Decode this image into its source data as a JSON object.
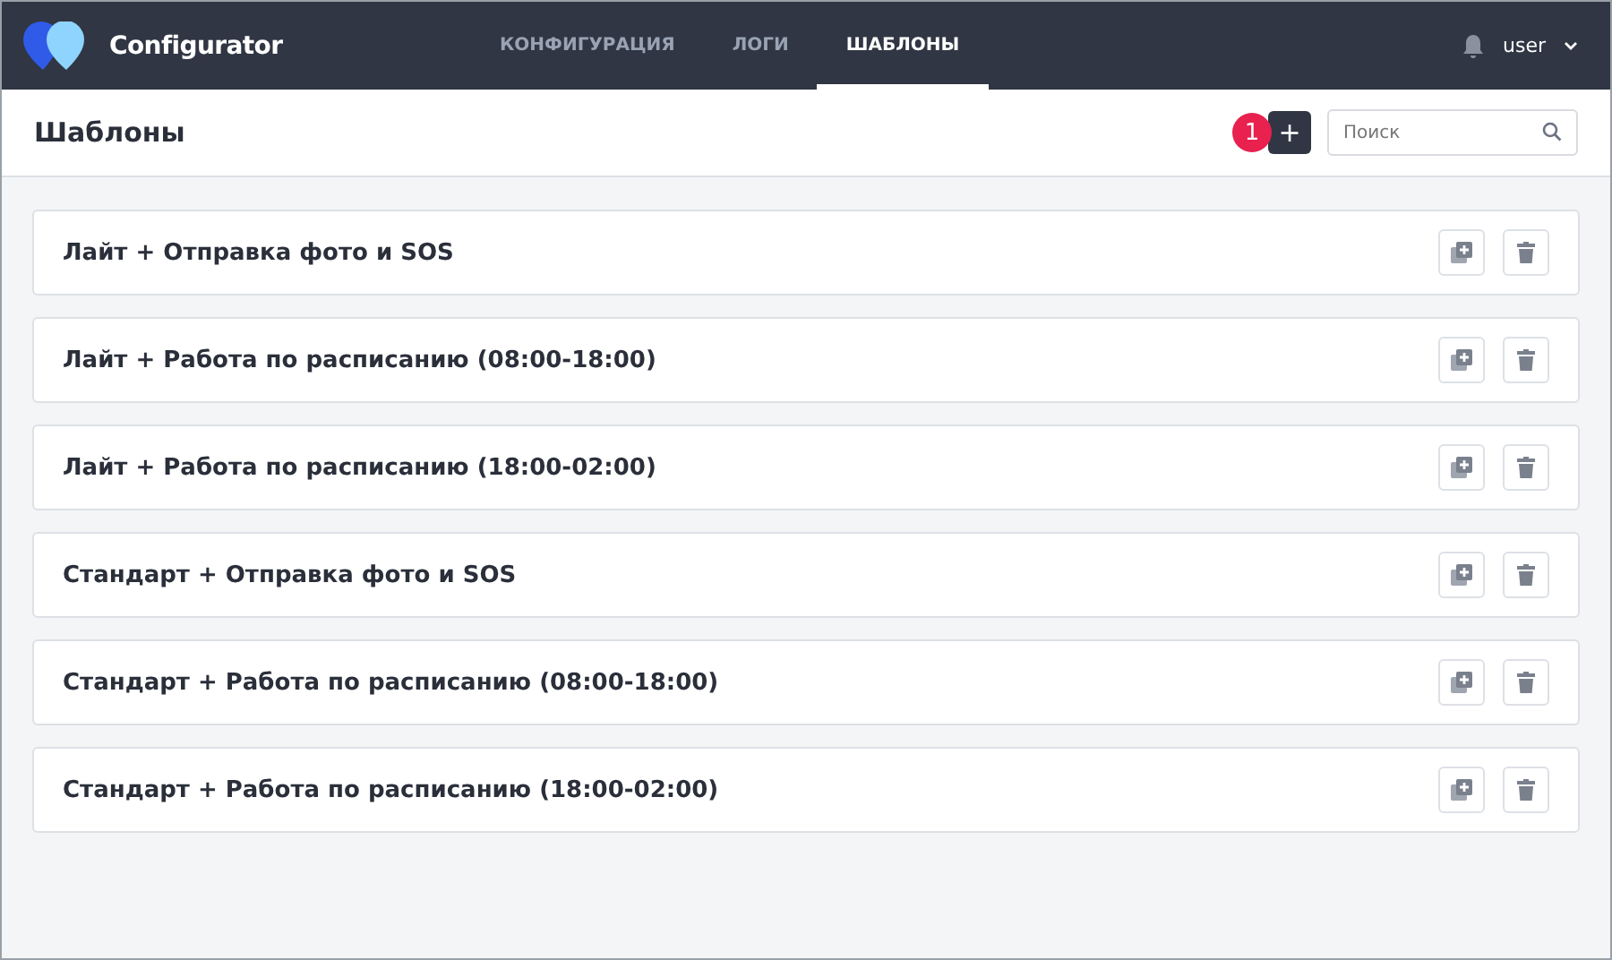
{
  "app": {
    "name": "Configurator"
  },
  "nav": [
    {
      "label": "КОНФИГУРАЦИЯ",
      "selected": false
    },
    {
      "label": "ЛОГИ",
      "selected": false
    },
    {
      "label": "ШАБЛОНЫ",
      "selected": true
    }
  ],
  "user": {
    "name": "user"
  },
  "page": {
    "title": "Шаблоны",
    "add_label": "+",
    "callout": "1",
    "search": {
      "placeholder": "Поиск"
    }
  },
  "templates": [
    {
      "name": "Лайт + Отправка фото и SOS"
    },
    {
      "name": "Лайт + Работа по расписанию (08:00-18:00)"
    },
    {
      "name": "Лайт + Работа по расписанию (18:00-02:00)"
    },
    {
      "name": "Стандарт + Отправка фото и SOS"
    },
    {
      "name": "Стандарт + Работа по расписанию (08:00-18:00)"
    },
    {
      "name": "Стандарт + Работа по расписанию (18:00-02:00)"
    }
  ]
}
